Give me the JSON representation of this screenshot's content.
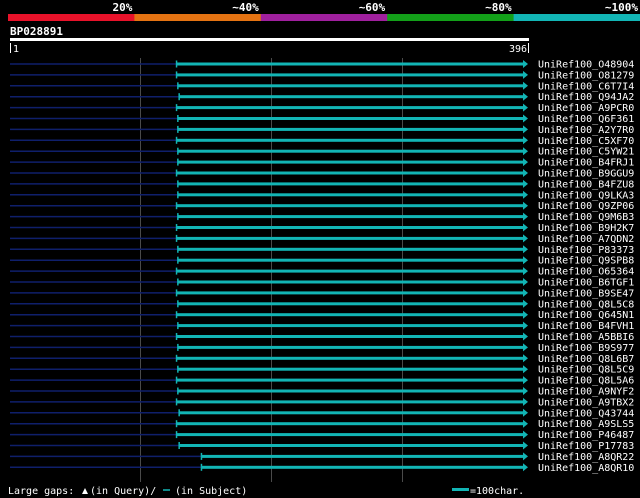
{
  "chart_data": {
    "type": "alignment",
    "query_id": "BP028891",
    "query_start": "1",
    "query_end": "396",
    "query_length": 396,
    "identity_scale": {
      "labels": [
        "20%",
        "~40%",
        "~60%",
        "~80%",
        "~100%"
      ],
      "colors": [
        "#e8122a",
        "#e57312",
        "#a0209e",
        "#13a019",
        "#12b5b5"
      ]
    },
    "hits": [
      {
        "name": "UniRef100_O48904",
        "start": 128,
        "end": 396
      },
      {
        "name": "UniRef100_O81279",
        "start": 128,
        "end": 396
      },
      {
        "name": "UniRef100_C6T7I4",
        "start": 129,
        "end": 396
      },
      {
        "name": "UniRef100_Q94JA2",
        "start": 130,
        "end": 396
      },
      {
        "name": "UniRef100_A9PCR0",
        "start": 128,
        "end": 396
      },
      {
        "name": "UniRef100_Q6F361",
        "start": 129,
        "end": 396
      },
      {
        "name": "UniRef100_A2Y7R0",
        "start": 129,
        "end": 396
      },
      {
        "name": "UniRef100_C5XF70",
        "start": 128,
        "end": 396
      },
      {
        "name": "UniRef100_C5YW21",
        "start": 129,
        "end": 396
      },
      {
        "name": "UniRef100_B4FRJ1",
        "start": 129,
        "end": 396
      },
      {
        "name": "UniRef100_B9GGU9",
        "start": 128,
        "end": 396
      },
      {
        "name": "UniRef100_B4FZU8",
        "start": 129,
        "end": 396
      },
      {
        "name": "UniRef100_Q9LKA3",
        "start": 129,
        "end": 396
      },
      {
        "name": "UniRef100_Q9ZP06",
        "start": 128,
        "end": 396
      },
      {
        "name": "UniRef100_Q9M6B3",
        "start": 129,
        "end": 396
      },
      {
        "name": "UniRef100_B9H2K7",
        "start": 128,
        "end": 396
      },
      {
        "name": "UniRef100_A7QDN2",
        "start": 128,
        "end": 396
      },
      {
        "name": "UniRef100_P83373",
        "start": 129,
        "end": 396
      },
      {
        "name": "UniRef100_Q9SPB8",
        "start": 129,
        "end": 396
      },
      {
        "name": "UniRef100_O65364",
        "start": 128,
        "end": 396
      },
      {
        "name": "UniRef100_B6TGF1",
        "start": 129,
        "end": 396
      },
      {
        "name": "UniRef100_B9SE47",
        "start": 128,
        "end": 396
      },
      {
        "name": "UniRef100_Q8L5C8",
        "start": 129,
        "end": 396
      },
      {
        "name": "UniRef100_Q645N1",
        "start": 128,
        "end": 396
      },
      {
        "name": "UniRef100_B4FVH1",
        "start": 129,
        "end": 396
      },
      {
        "name": "UniRef100_A5BBI6",
        "start": 128,
        "end": 396
      },
      {
        "name": "UniRef100_B9S977",
        "start": 129,
        "end": 396
      },
      {
        "name": "UniRef100_Q8L6B7",
        "start": 128,
        "end": 396
      },
      {
        "name": "UniRef100_Q8L5C9",
        "start": 129,
        "end": 396
      },
      {
        "name": "UniRef100_Q8L5A6",
        "start": 128,
        "end": 396
      },
      {
        "name": "UniRef100_A9NYF2",
        "start": 129,
        "end": 396
      },
      {
        "name": "UniRef100_A9TBX2",
        "start": 128,
        "end": 396
      },
      {
        "name": "UniRef100_Q43744",
        "start": 130,
        "end": 396
      },
      {
        "name": "UniRef100_A9SLS5",
        "start": 128,
        "end": 396
      },
      {
        "name": "UniRef100_P46487",
        "start": 128,
        "end": 396
      },
      {
        "name": "UniRef100_P17783",
        "start": 130,
        "end": 396
      },
      {
        "name": "UniRef100_A8QR22",
        "start": 147,
        "end": 396
      },
      {
        "name": "UniRef100_A8QR10",
        "start": 147,
        "end": 396
      }
    ],
    "legend": {
      "large_gaps": "Large gaps:",
      "gap_query": "(in Query)/",
      "gap_subject": "(in Subject)",
      "scale_label": "=100char."
    },
    "colors": {
      "background": "#000000",
      "hit_line": "#12b5b5",
      "unaligned": "#0f1f6b",
      "grid": "#4a4a4a",
      "text": "#ffffff"
    }
  }
}
